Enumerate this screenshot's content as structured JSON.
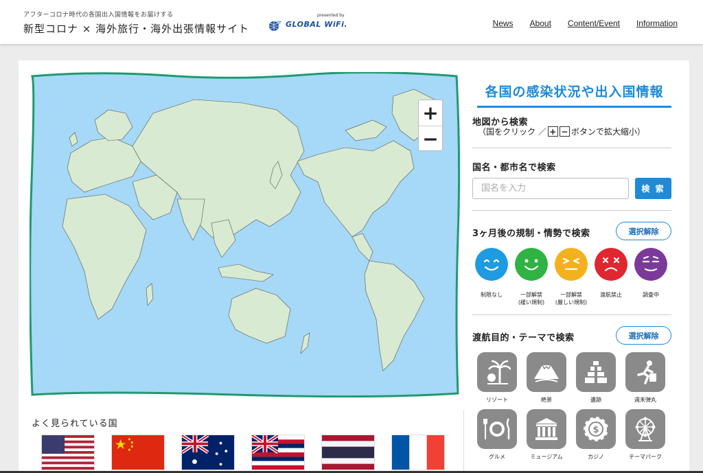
{
  "header": {
    "tagline": "アフターコロナ時代の各国出入国情報をお届けする",
    "site_title": "新型コロナ × 海外旅行・海外出張情報サイト",
    "brand_presented": "presented by",
    "brand_name": "GLOBAL WiFi.",
    "nav": [
      "News",
      "About",
      "Content/Event",
      "Information"
    ]
  },
  "map": {
    "zoom_in": "+",
    "zoom_out": "−",
    "ocean_color": "#a6d8f7",
    "land_color": "#d8ead1",
    "frame_color": "#1f9a6f"
  },
  "popular": {
    "title": "よく見られている国",
    "flags": [
      "usa-flag",
      "china-flag",
      "australia-flag",
      "hawaii-flag",
      "thailand-flag",
      "france-flag"
    ]
  },
  "side": {
    "title": "各国の感染状況や出入国情報",
    "map_search_title": "地図から検索",
    "hint_open": "（国をクリック ／",
    "hint_plus": "+",
    "hint_minus": "−",
    "hint_close": "ボタンで拡大縮小）",
    "name_search_title": "国名・都市名で検索",
    "name_search_placeholder": "国名を入力",
    "search_button": "検 索",
    "regulation_title": "3ヶ月後の規制・情勢で検索",
    "clear_button": "選択解除",
    "regulation_levels": [
      {
        "label": "制限なし",
        "color": "#1e9be3",
        "icon": "smile-face-icon"
      },
      {
        "label": "一部解禁\n(緩い規制)",
        "color": "#2fb342",
        "icon": "grin-face-icon"
      },
      {
        "label": "一部解禁\n(厳しい規制)",
        "color": "#f3b21d",
        "icon": "squint-face-icon"
      },
      {
        "label": "渡航禁止",
        "color": "#e0262f",
        "icon": "dead-face-icon"
      },
      {
        "label": "調査中",
        "color": "#7b3a9a",
        "icon": "sleepy-face-icon"
      }
    ],
    "theme_title": "渡航目的・テーマで検索",
    "themes": [
      {
        "label": "リゾート",
        "icon": "resort-icon"
      },
      {
        "label": "絶景",
        "icon": "mountain-icon"
      },
      {
        "label": "遺跡",
        "icon": "pyramid-icon"
      },
      {
        "label": "週末弾丸",
        "icon": "runner-icon"
      },
      {
        "label": "グルメ",
        "icon": "gourmet-icon"
      },
      {
        "label": "ミュージアム",
        "icon": "museum-icon"
      },
      {
        "label": "カジノ",
        "icon": "casino-chip-icon"
      },
      {
        "label": "テーマパーク",
        "icon": "ferris-wheel-icon"
      }
    ]
  }
}
